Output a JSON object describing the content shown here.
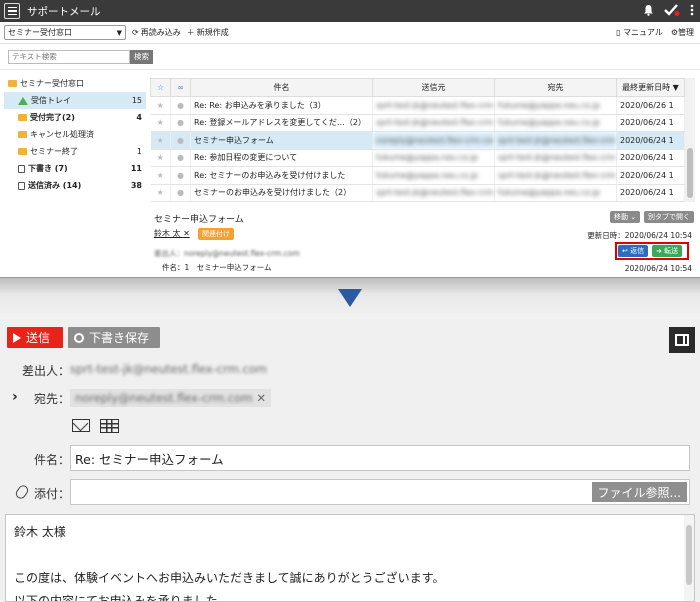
{
  "app": {
    "title": "サポートメール"
  },
  "toolbar": {
    "mailbox": "セミナー受付窓口",
    "reload": "再読み込み",
    "new": "新規作成",
    "manual": "マニュアル",
    "admin": "管理"
  },
  "search": {
    "placeholder": "テキスト検索",
    "button": "検索"
  },
  "folders": [
    {
      "label": "セミナー受付窓口",
      "count": "",
      "icon": "folder-open-icon"
    },
    {
      "label": "受信トレイ",
      "count": "15",
      "icon": "inbox-icon"
    },
    {
      "label": "受付完了(2)",
      "count": "4",
      "icon": "folder-icon"
    },
    {
      "label": "キャンセル処理済",
      "count": "",
      "icon": "folder-icon"
    },
    {
      "label": "セミナー終了",
      "count": "1",
      "icon": "folder-icon"
    },
    {
      "label": "下書き (7)",
      "count": "11",
      "icon": "draft-icon"
    },
    {
      "label": "送信済み (14)",
      "count": "38",
      "icon": "sent-icon"
    }
  ],
  "list": {
    "headers": {
      "subject": "件名",
      "from": "送信元",
      "to": "宛先",
      "updated": "最終更新日時 ▼"
    },
    "rows": [
      {
        "subject": "Re: Re: お申込みを承りました（3）",
        "from": "sprt-test-jk@neutest.flex-crm.com",
        "to": "fukume@yappa.neu.co.jp",
        "date": "2020/06/26 1"
      },
      {
        "subject": "Re: 登録メールアドレスを変更してくだ…（2）",
        "from": "sprt-test-jk@neutest.flex-crm.com",
        "to": "fukume@yappa.neu.co.jp",
        "date": "2020/06/24 1"
      },
      {
        "subject": "セミナー申込フォーム",
        "from": "noreply@neutest.flex-crm.com",
        "to": "sprt-test-jk@neutest.flex-crm.com",
        "date": "2020/06/24 1"
      },
      {
        "subject": "Re: 参加日程の変更について",
        "from": "fukume@yappa.neu.co.jp",
        "to": "sprt-test-jk@neutest.flex-crm.com",
        "date": "2020/06/24 1"
      },
      {
        "subject": "Re: セミナーのお申込みを受け付けました",
        "from": "fukume@yappa.neu.co.jp",
        "to": "sprt-test-jk@neutest.flex-crm.com",
        "date": "2020/06/24 1"
      },
      {
        "subject": "セミナーのお申込みを受け付けました（2）",
        "from": "sprt-test-jk@neutest.flex-crm.com",
        "to": "fukume@yappa.neu.co.jp",
        "date": "2020/06/24 1"
      }
    ]
  },
  "preview": {
    "subject": "セミナー申込フォーム",
    "from_name": "鈴木 太",
    "tag": "関連付け",
    "move": "移動",
    "open_tab": "別タブで開く",
    "updated": "更新日時：2020/06/24 10:54",
    "sender": "差出人：noreply@neutest.flex-crm.com",
    "count_label": "件名：1　セミナー申込フォーム",
    "reply": "返信",
    "forward": "転送",
    "date": "2020/06/24 10:54"
  },
  "compose": {
    "send": "送信",
    "draft": "下書き保存",
    "from_label": "差出人：",
    "from_value": "sprt-test-jk@neutest.flex-crm.com",
    "to_label": "宛先：",
    "to_value": "noreply@neutest.flex-crm.com",
    "subject_label": "件名：",
    "subject_value": "Re: セミナー申込フォーム",
    "attach_label": "添付：",
    "file_button": "ファイル参照...",
    "body_lines": [
      "鈴木 太様",
      "",
      "この度は、体験イベントへお申込みいただきまして誠にありがとうございます。",
      "以下の内容にてお申込みを承りました。"
    ]
  }
}
